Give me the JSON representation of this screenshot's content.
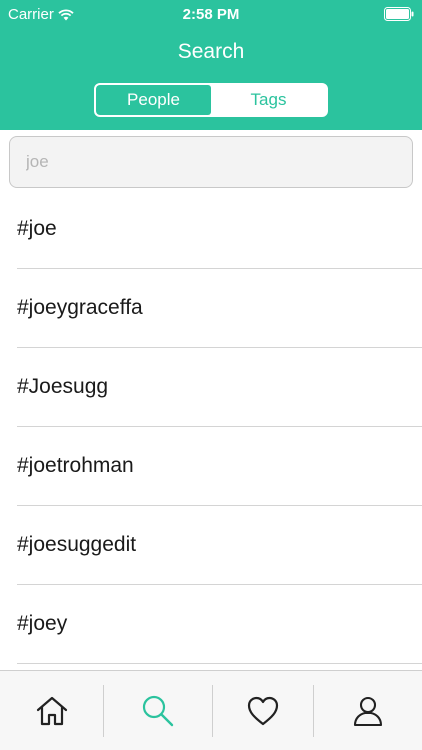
{
  "status_bar": {
    "carrier": "Carrier",
    "time": "2:58 PM",
    "wifi_icon": "wifi-icon",
    "battery_icon": "battery-icon"
  },
  "header": {
    "title": "Search",
    "segments": [
      {
        "label": "People",
        "active": true
      },
      {
        "label": "Tags",
        "active": false
      }
    ]
  },
  "search": {
    "value": "joe",
    "placeholder": ""
  },
  "results": [
    {
      "label": "#joe"
    },
    {
      "label": "#joeygraceffa"
    },
    {
      "label": "#Joesugg"
    },
    {
      "label": "#joetrohman"
    },
    {
      "label": "#joesuggedit"
    },
    {
      "label": "#joey"
    }
  ],
  "tabbar": {
    "tabs": [
      {
        "icon": "home-icon",
        "active": false
      },
      {
        "icon": "search-icon",
        "active": true
      },
      {
        "icon": "heart-icon",
        "active": false
      },
      {
        "icon": "profile-icon",
        "active": false
      }
    ]
  },
  "colors": {
    "accent": "#2bc39e",
    "text": "#1a1a1a",
    "tab_icon": "#222222"
  }
}
